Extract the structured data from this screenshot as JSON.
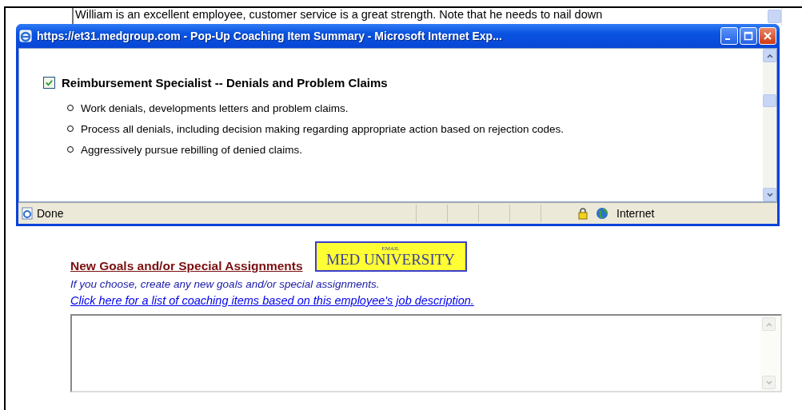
{
  "background_comment": {
    "value": "William is an excellent employee, customer service is a great strength.  Note that he needs to nail down"
  },
  "popup": {
    "title": "https://et31.medgroup.com - Pop-Up Coaching Item Summary - Microsoft Internet Exp...",
    "item": {
      "label": "Reimbursement Specialist -- Denials and Problem Claims",
      "checked": true
    },
    "bullets": [
      "Work denials, developments letters and problem claims.",
      "Process all denials, including decision making regarding appropriate action based on rejection codes.",
      "Aggressively pursue rebilling of denied claims."
    ],
    "status_bar": {
      "text": "Done",
      "zone": "Internet"
    }
  },
  "section": {
    "heading": "New Goals and/or Special Assignments",
    "logo": {
      "small": "EMAIL",
      "main": "MED UNIVERSITY"
    },
    "instruction": "If you choose, create any new goals and/or special assignments.",
    "link": "Click here for a list of coaching items based on this employee's job description."
  }
}
